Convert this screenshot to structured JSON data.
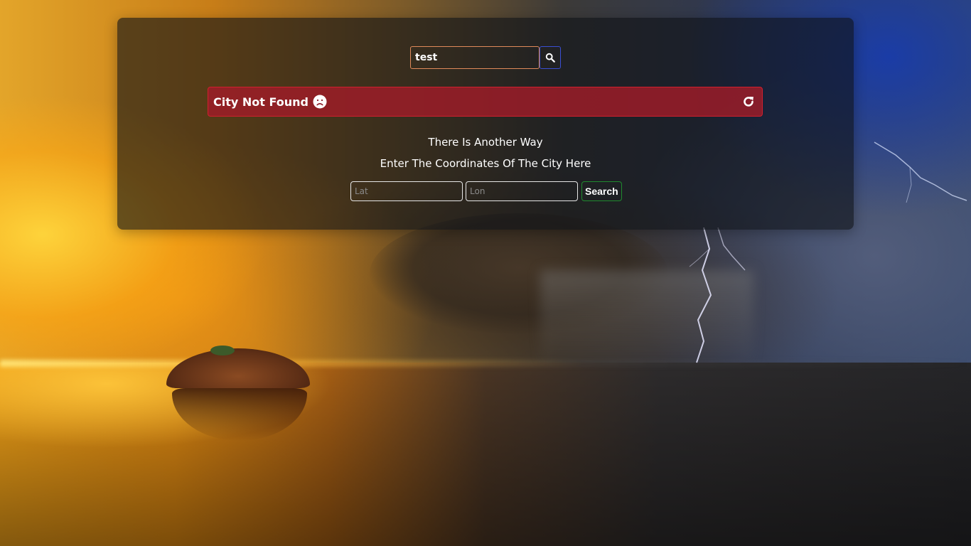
{
  "search": {
    "value": "test",
    "button_icon": "search-icon"
  },
  "error": {
    "message": "City Not Found",
    "emoji_icon": "sad-face-icon",
    "refresh_icon": "refresh-icon",
    "color": "#a01c28"
  },
  "alternative": {
    "line1": "There Is Another Way",
    "line2": "Enter The Coordinates Of The City Here",
    "lat_placeholder": "Lat",
    "lon_placeholder": "Lon",
    "search_label": "Search"
  }
}
